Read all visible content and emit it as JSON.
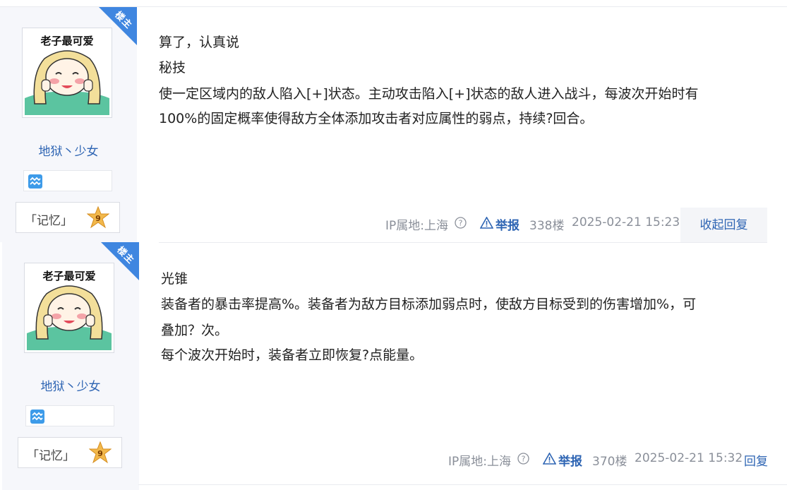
{
  "posts": [
    {
      "floor_badge": "楼主",
      "avatar_caption": "老子最可爱",
      "username": "地狱丶少女",
      "level_name": "「记忆」",
      "level": "9",
      "content": [
        "算了，认真说",
        "秘技",
        "使一定区域内的敌人陷入[+]状态。主动攻击陷入[+]状态的敌人进入战斗，每波次开始时有",
        "100%的固定概率使得敌方全体添加攻击者对应属性的弱点，持续?回合。"
      ],
      "ip_location": "IP属地:上海",
      "report_label": "举报",
      "floor": "338楼",
      "timestamp": "2025-02-21 15:23",
      "reply_label": "收起回复"
    },
    {
      "floor_badge": "楼主",
      "avatar_caption": "老子最可爱",
      "username": "地狱丶少女",
      "level_name": "「记忆」",
      "level": "9",
      "content": [
        "光锥",
        "装备者的暴击率提高%。装备者为敌方目标添加弱点时，使敌方目标受到的伤害增加%，可",
        "叠加？次。",
        "每个波次开始时，装备者立即恢复?点能量。"
      ],
      "ip_location": "IP属地:上海",
      "report_label": "举报",
      "floor": "370楼",
      "timestamp": "2025-02-21 15:32",
      "reply_label": "回复"
    }
  ],
  "colors": {
    "link": "#2d64b3",
    "badge": "#3f86e0",
    "sidebar_bg": "#f6f7fb",
    "level_star": "#f2b84b"
  },
  "icons": [
    "aquarius-icon",
    "level-star-icon",
    "help-icon",
    "warning-icon"
  ]
}
